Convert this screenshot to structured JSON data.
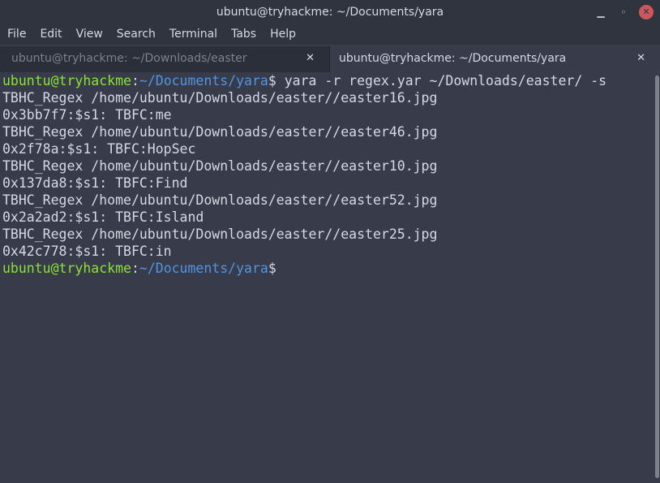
{
  "window": {
    "title": "ubuntu@tryhackme: ~/Documents/yara"
  },
  "menu": [
    "File",
    "Edit",
    "View",
    "Search",
    "Terminal",
    "Tabs",
    "Help"
  ],
  "tabs": [
    {
      "label": "ubuntu@tryhackme: ~/Downloads/easter",
      "close": "✕"
    },
    {
      "label": "ubuntu@tryhackme: ~/Documents/yara",
      "close": "✕"
    }
  ],
  "terminal": {
    "prompt_user": "ubuntu@tryhackme",
    "prompt_sep": ":",
    "prompt_path": "~/Documents/yara",
    "prompt_end": "$",
    "command": " yara -r regex.yar ~/Downloads/easter/ -s",
    "output": [
      "TBHC_Regex /home/ubuntu/Downloads/easter//easter16.jpg",
      "0x3bb7f7:$s1: TBFC:me",
      "TBHC_Regex /home/ubuntu/Downloads/easter//easter46.jpg",
      "0x2f78a:$s1: TBFC:HopSec",
      "TBHC_Regex /home/ubuntu/Downloads/easter//easter10.jpg",
      "0x137da8:$s1: TBFC:Find",
      "TBHC_Regex /home/ubuntu/Downloads/easter//easter52.jpg",
      "0x2a2ad2:$s1: TBFC:Island",
      "TBHC_Regex /home/ubuntu/Downloads/easter//easter25.jpg",
      "0x42c778:$s1: TBFC:in"
    ]
  },
  "icons": {
    "minimize": "minimize-icon",
    "maximize": "maximize-icon",
    "close": "close-icon"
  }
}
